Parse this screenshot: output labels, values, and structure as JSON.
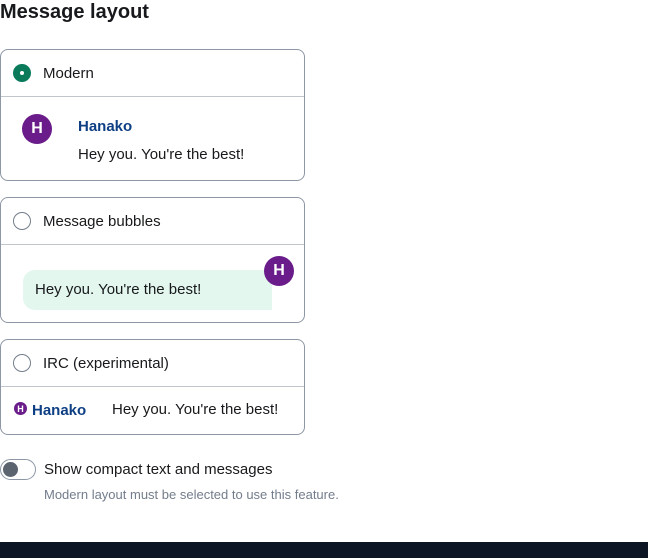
{
  "section": {
    "title": "Message layout"
  },
  "options": {
    "modern": {
      "label": "Modern",
      "selected": true,
      "preview": {
        "avatar_letter": "H",
        "sender": "Hanako",
        "message": "Hey you. You're the best!"
      }
    },
    "bubbles": {
      "label": "Message bubbles",
      "selected": false,
      "preview": {
        "avatar_letter": "H",
        "message": "Hey you. You're the best!"
      }
    },
    "irc": {
      "label": "IRC (experimental)",
      "selected": false,
      "preview": {
        "avatar_letter": "H",
        "sender": "Hanako",
        "message": "Hey you. You're the best!"
      }
    }
  },
  "compact": {
    "label": "Show compact text and messages",
    "help": "Modern layout must be selected to use this feature.",
    "enabled": false
  },
  "colors": {
    "accent": "#0b7a5b",
    "avatar": "#6a1d8a",
    "sender": "#0e3f84",
    "bubble": "#e3f7ee"
  }
}
